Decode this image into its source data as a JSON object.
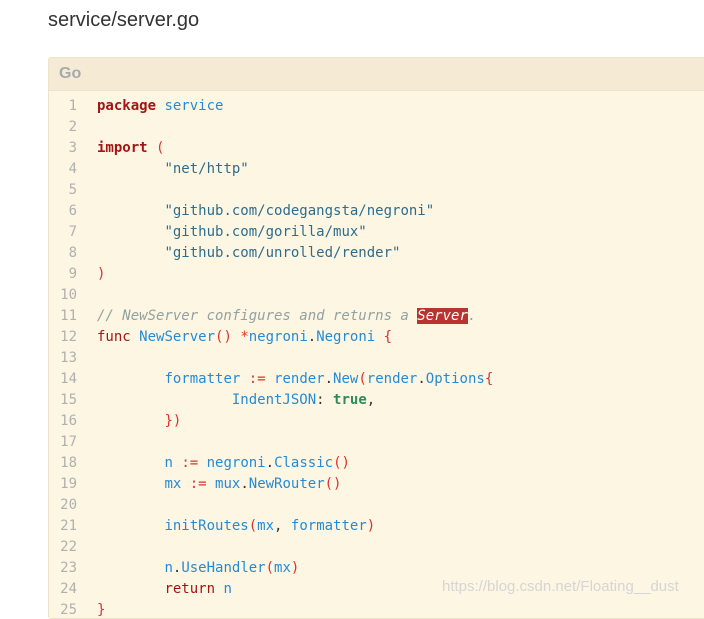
{
  "file": {
    "title": "service/server.go"
  },
  "code": {
    "language": "Go",
    "line_numbers": [
      "1",
      "2",
      "3",
      "4",
      "5",
      "6",
      "7",
      "8",
      "9",
      "10",
      "11",
      "12",
      "13",
      "14",
      "15",
      "16",
      "17",
      "18",
      "19",
      "20",
      "21",
      "22",
      "23",
      "24",
      "25"
    ],
    "lines": {
      "l1": [
        "package",
        " ",
        "service"
      ],
      "l3": [
        "import",
        " ",
        "("
      ],
      "l4": [
        "\t",
        "\"net/http\""
      ],
      "l6": [
        "\t",
        "\"github.com/codegangsta/negroni\""
      ],
      "l7": [
        "\t",
        "\"github.com/gorilla/mux\""
      ],
      "l8": [
        "\t",
        "\"github.com/unrolled/render\""
      ],
      "l9": [
        ")"
      ],
      "l11": [
        "// NewServer configures and returns a ",
        "Server",
        "."
      ],
      "l12": [
        "func",
        " ",
        "NewServer",
        "()",
        " ",
        "*",
        "negroni",
        ".",
        "Negroni",
        " ",
        "{"
      ],
      "l14": [
        "\t",
        "formatter",
        " ",
        ":=",
        " ",
        "render",
        ".",
        "New",
        "(",
        "render",
        ".",
        "Options",
        "{"
      ],
      "l15": [
        "\t\t",
        "IndentJSON",
        ":",
        " ",
        "true",
        ","
      ],
      "l16": [
        "\t",
        "})"
      ],
      "l18": [
        "\t",
        "n",
        " ",
        ":=",
        " ",
        "negroni",
        ".",
        "Classic",
        "()"
      ],
      "l19": [
        "\t",
        "mx",
        " ",
        ":=",
        " ",
        "mux",
        ".",
        "NewRouter",
        "()"
      ],
      "l21": [
        "\t",
        "initRoutes",
        "(",
        "mx",
        ",",
        " ",
        "formatter",
        ")"
      ],
      "l23": [
        "\t",
        "n",
        ".",
        "UseHandler",
        "(",
        "mx",
        ")"
      ],
      "l24": [
        "\t",
        "return",
        " ",
        "n"
      ],
      "l25": [
        "}"
      ]
    }
  },
  "watermark": "https://blog.csdn.net/Floating__dust"
}
